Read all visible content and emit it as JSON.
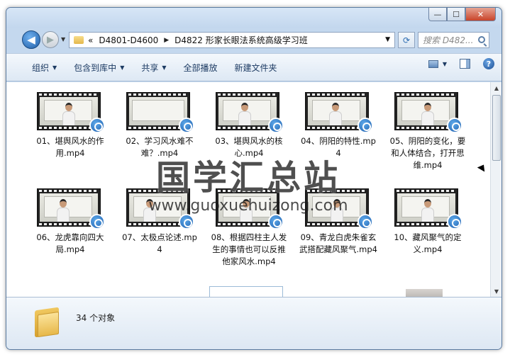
{
  "window": {
    "minimize_glyph": "—",
    "maximize_glyph": "☐",
    "close_glyph": "✕"
  },
  "nav": {
    "back_glyph": "◀",
    "forward_glyph": "▶",
    "history_glyph": "▼",
    "breadcrumb": [
      "D4801-D4600",
      "D4822 形家长眼法系统高级学习班"
    ],
    "breadcrumb_prefix": "«",
    "search_placeholder": "搜索 D482..."
  },
  "toolbar": {
    "items": [
      {
        "label": "组织",
        "has_dropdown": true
      },
      {
        "label": "包含到库中",
        "has_dropdown": true
      },
      {
        "label": "共享",
        "has_dropdown": true
      },
      {
        "label": "全部播放",
        "has_dropdown": false
      },
      {
        "label": "新建文件夹",
        "has_dropdown": false
      }
    ]
  },
  "files": [
    {
      "name": "01、堪舆风水的作用.mp4"
    },
    {
      "name": "02、学习风水难不难？.mp4"
    },
    {
      "name": "03、堪舆风水的核心.mp4"
    },
    {
      "name": "04、阴阳的特性.mp4"
    },
    {
      "name": "05、阴阳的变化，要和人体结合，打开思维.mp4"
    },
    {
      "name": "06、龙虎靠向四大局.mp4"
    },
    {
      "name": "07、太极点论述.mp4"
    },
    {
      "name": "08、根据四柱主人发生的事情也可以反推他家风水.mp4"
    },
    {
      "name": "09、青龙白虎朱雀玄武搭配藏风聚气.mp4"
    },
    {
      "name": "10、藏风聚气的定义.mp4"
    }
  ],
  "watermark": {
    "title": "国学汇总站",
    "url": "www.guoxuehuizong.com"
  },
  "details": {
    "count_text": "34 个对象"
  },
  "colors": {
    "chrome": "#c4d8ee",
    "toolbar_text": "#1d3b63",
    "badge_blue": "#1d5fae"
  }
}
